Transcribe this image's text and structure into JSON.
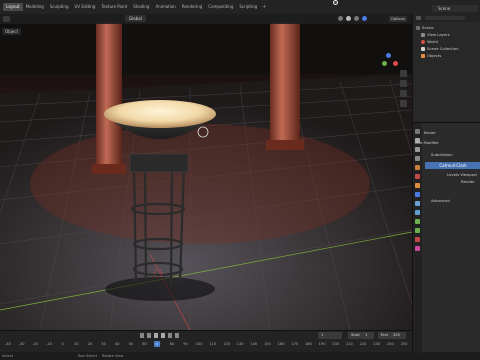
{
  "topbar": {
    "menu": [
      "Layout",
      "Modeling",
      "Sculpting",
      "UV Editing",
      "Texture Paint",
      "Shading",
      "Animation",
      "Rendering",
      "Compositing",
      "Scripting"
    ],
    "active_index": 0,
    "add_workspace": "+",
    "scene_label": "Scene"
  },
  "viewport": {
    "mode": "Object",
    "orientation": "Global",
    "options_label": "Options"
  },
  "timeline": {
    "ticks": [
      "-40",
      "-30",
      "-20",
      "-10",
      "0",
      "10",
      "20",
      "30",
      "40",
      "50",
      "60",
      "70",
      "80",
      "90",
      "100",
      "110",
      "120",
      "130",
      "140",
      "150",
      "160",
      "170",
      "180",
      "190",
      "200",
      "210",
      "220",
      "230",
      "240",
      "250"
    ],
    "current_frame": "1",
    "start_label": "Start",
    "start_value": "1",
    "end_label": "End",
    "end_value": "250",
    "playhead_value": "1"
  },
  "statusbar": {
    "items": [
      "Select",
      "Box Select",
      "Rotate View"
    ]
  },
  "outliner": {
    "rows": [
      {
        "label": "Scene",
        "depth": 0,
        "color": "#6e6e6e"
      },
      {
        "label": "View Layers",
        "depth": 1,
        "color": "#8a8a8a"
      },
      {
        "label": "World",
        "depth": 1,
        "color": "#d0524a"
      },
      {
        "label": "Scene Collection",
        "depth": 1,
        "color": "#d4d4d4"
      },
      {
        "label": "Objects",
        "depth": 1,
        "color": "#e38d3e"
      }
    ]
  },
  "properties": {
    "object_name": "Bezier",
    "add_modifier": "Add Modifier",
    "modifier_name": "Subdivision",
    "catmull_clark": "Catmull-Clark",
    "levels_viewport": "Levels Viewport",
    "render_label": "Render",
    "advanced": "Advanced"
  },
  "colors": {
    "accent": "#4772b3",
    "x_axis": "#e24a4a",
    "y_axis": "#6ab04c",
    "z_axis": "#4a7be2"
  }
}
